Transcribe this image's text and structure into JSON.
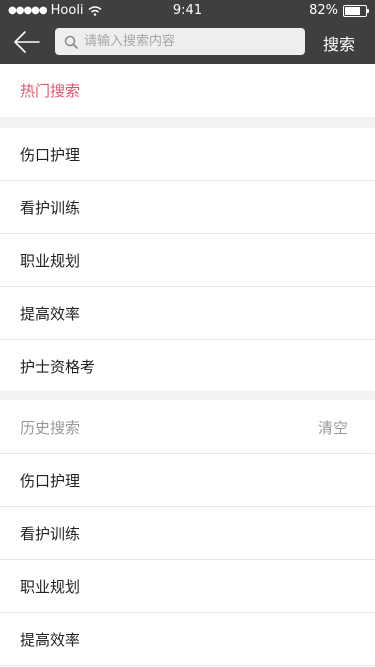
{
  "status_bar": {
    "signal": "●●●●●",
    "carrier": "Hooli",
    "time": "9:41",
    "battery_label": "82%",
    "battery_level": 0.82
  },
  "nav": {
    "search_placeholder": "请输入搜索内容",
    "search_button": "搜索"
  },
  "hot": {
    "title": "热门搜索",
    "items": [
      "伤口护理",
      "看护训练",
      "职业规划",
      "提高效率",
      "护士资格考"
    ]
  },
  "history": {
    "title": "历史搜索",
    "clear_label": "清空",
    "items": [
      "伤口护理",
      "看护训练",
      "职业规划",
      "提高效率"
    ]
  },
  "colors": {
    "bar_bg": "#3f3f3f",
    "accent": "#e0556f",
    "section_gap": "#f2f2f5"
  },
  "icons": [
    "back-arrow-icon",
    "search-icon",
    "wifi-icon",
    "battery-icon"
  ]
}
